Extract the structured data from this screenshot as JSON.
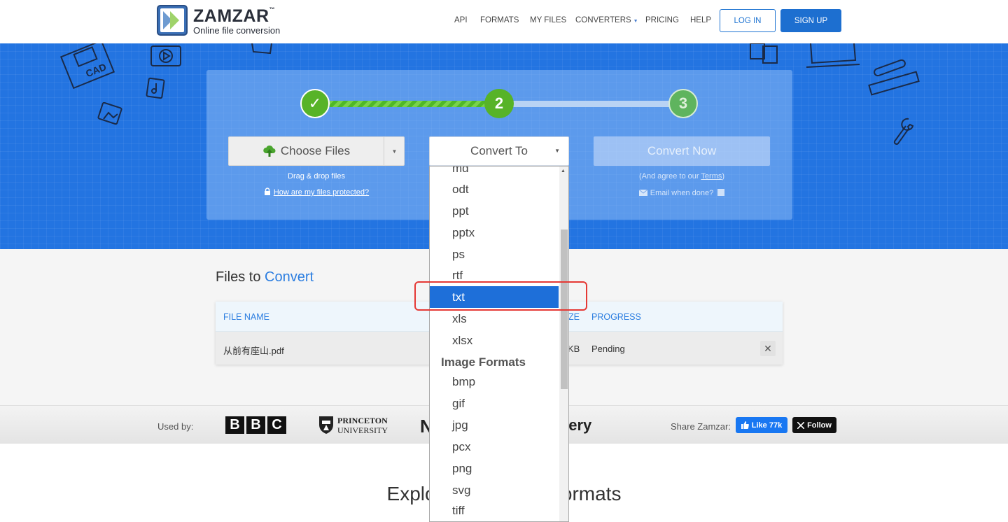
{
  "brand": {
    "name": "ZAMZAR",
    "trademark": "™",
    "tagline": "Online file conversion"
  },
  "nav": {
    "items": [
      "API",
      "FORMATS",
      "MY FILES",
      "CONVERTERS",
      "PRICING",
      "HELP"
    ],
    "login": "LOG IN",
    "signup": "SIGN UP"
  },
  "steps": {
    "step1": "✓",
    "step2": "2",
    "step3": "3"
  },
  "upload": {
    "choose_files": "Choose Files",
    "drag_drop": "Drag & drop files",
    "protected_link": "How are my files protected?"
  },
  "convert": {
    "convert_to": "Convert To",
    "convert_now": "Convert Now",
    "agree_prefix": "(And agree to our ",
    "agree_link": "Terms",
    "agree_suffix": ")",
    "email_label": "Email when done?"
  },
  "dropdown": {
    "partial_top": "md",
    "options_top": [
      "odt",
      "ppt",
      "pptx",
      "ps",
      "rtf"
    ],
    "selected": "txt",
    "options_after": [
      "xls",
      "xlsx"
    ],
    "group_label": "Image Formats",
    "image_options": [
      "bmp",
      "gif",
      "jpg",
      "pcx",
      "png",
      "svg",
      "tiff"
    ]
  },
  "files": {
    "title_prefix": "Files to ",
    "title_accent": "Convert",
    "headers": {
      "file_name": "FILE NAME",
      "size_partial": "ZE",
      "progress": "PROGRESS"
    },
    "row": {
      "file_name": "从前有座山.pdf",
      "size_partial": "KB",
      "progress": "Pending",
      "delete": "✕"
    }
  },
  "usedby": {
    "label": "Used by:",
    "bbc": [
      "B",
      "B",
      "C"
    ],
    "princeton_1": "PRINCETON",
    "princeton_2": "UNIVERSITY",
    "partial_n": "N",
    "partial_discovery": "very",
    "share_label": "Share Zamzar:",
    "fb_like": "Like 77k",
    "x_follow": "Follow"
  },
  "explore": {
    "left": "Explor",
    "right": "ormats"
  },
  "colors": {
    "accent": "#1d6fd0",
    "hero": "#2374e1",
    "green": "#57b328",
    "selected": "#1e6fd9",
    "highlight": "#e53935"
  }
}
